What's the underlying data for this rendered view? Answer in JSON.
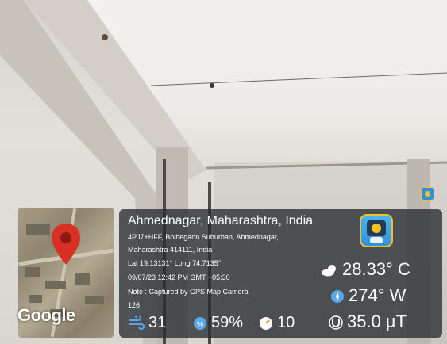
{
  "location": {
    "title": "Ahmednagar, Maharashtra, India",
    "address_line1": "4PJ7+HFF, Bolhegaon Suburban, Ahmednagar,",
    "address_line2": "Maharashtra 414111, India",
    "coords": "Lat 19.13131° Long 74.7135°",
    "datetime": "09/07/23 12:42 PM GMT +05:30",
    "note": "Note : Captured by GPS Map Camera",
    "altitude": "126"
  },
  "map": {
    "brand": "Google"
  },
  "weather": {
    "temperature": "28.33° C",
    "wind_direction": "274° W",
    "magnetic": "35.0 µT",
    "wind_speed": "31",
    "humidity": "59%",
    "pressure": "10"
  },
  "colors": {
    "panel": "#2c3036",
    "pin": "#d93025",
    "accent": "#2f8fd8"
  },
  "icons": [
    "map-pin-icon",
    "gps-map-camera-app-icon",
    "weather-cloud-icon",
    "compass-icon",
    "magnet-icon",
    "wind-icon",
    "humidity-icon",
    "pressure-gauge-icon"
  ]
}
